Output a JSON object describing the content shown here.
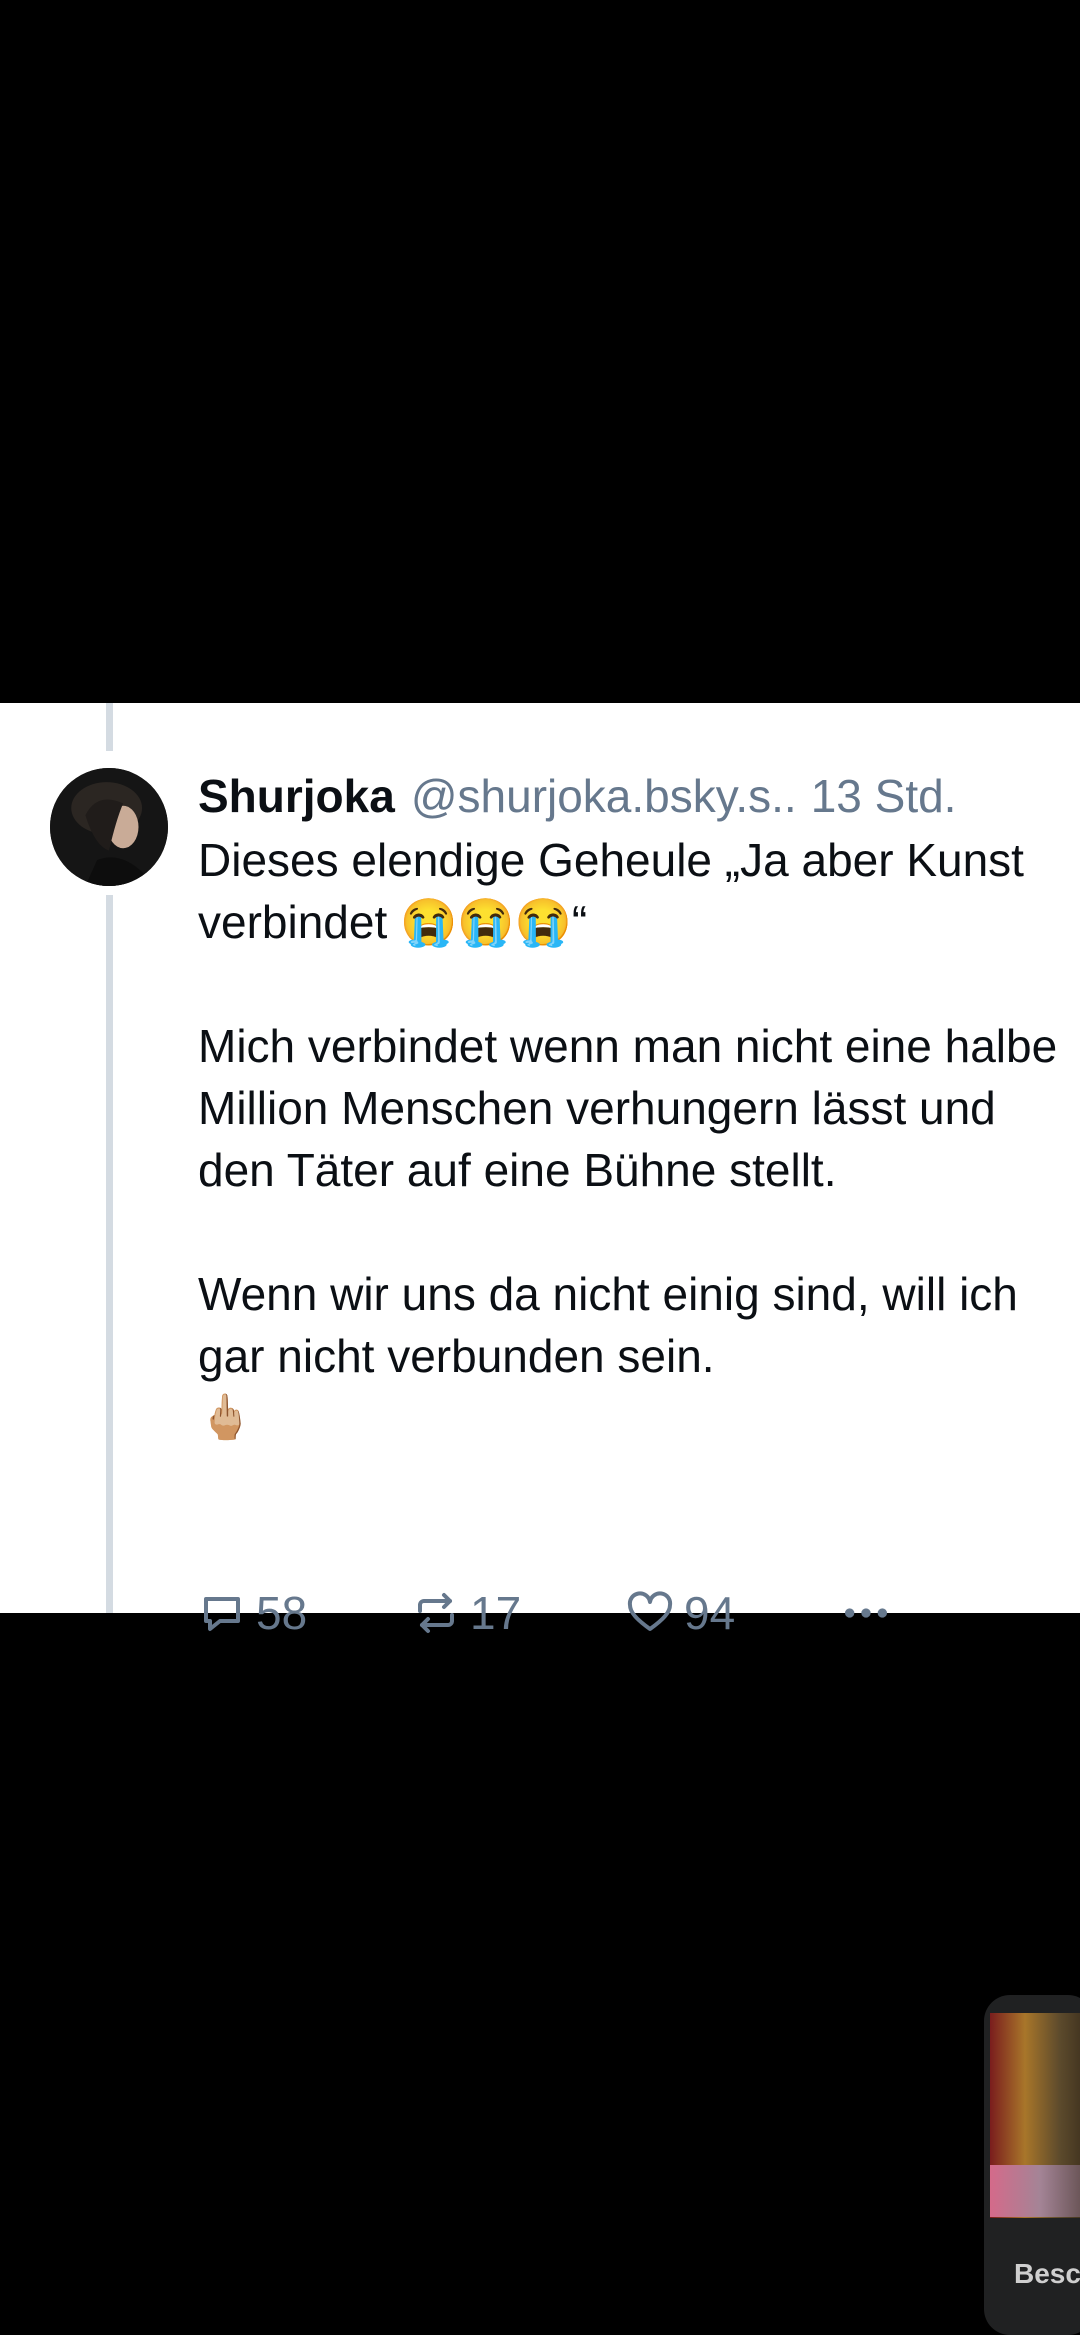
{
  "post": {
    "author": {
      "display_name": "Shurjoka",
      "handle": "@shurjoka.bsky.s.."
    },
    "timestamp": "13 Std.",
    "text": "Dieses elendige Geheule „Ja aber Kunst verbindet 😭😭😭“\n\nMich verbindet wenn man nicht eine halbe Million Menschen verhungern lässt und den Täter auf eine Bühne stellt.\n\nWenn wir uns da nicht einig sind, will ich gar nicht verbunden sein.",
    "emoji_line": "🖕🏼",
    "actions": {
      "reply_count": "58",
      "repost_count": "17",
      "like_count": "94"
    }
  },
  "pip_player": {
    "label": "Besc"
  },
  "colors": {
    "background": "#000000",
    "card": "#ffffff",
    "text": "#0b0f14",
    "secondary_text": "#66788d",
    "thread_line": "#d4dbe2"
  },
  "icons": [
    "reply-icon",
    "repost-icon",
    "like-icon",
    "more-icon"
  ]
}
